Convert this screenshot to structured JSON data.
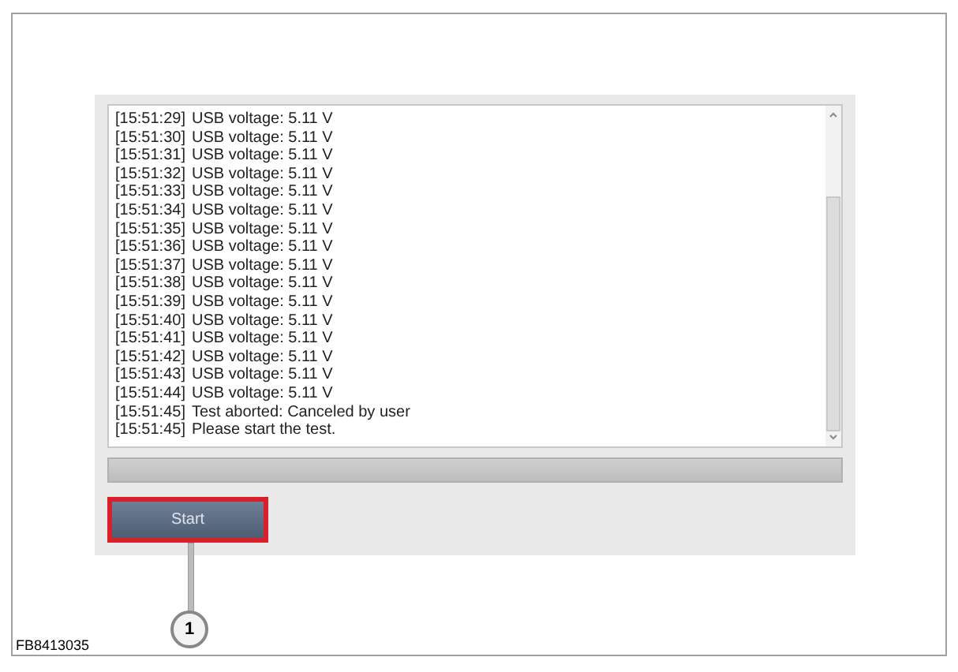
{
  "log": {
    "lines": [
      {
        "time": "[15:51:29]",
        "message": "USB voltage: 5.11 V"
      },
      {
        "time": "[15:51:30]",
        "message": "USB voltage: 5.11 V"
      },
      {
        "time": "[15:51:31]",
        "message": "USB voltage: 5.11 V"
      },
      {
        "time": "[15:51:32]",
        "message": "USB voltage: 5.11 V"
      },
      {
        "time": "[15:51:33]",
        "message": "USB voltage: 5.11 V"
      },
      {
        "time": "[15:51:34]",
        "message": "USB voltage: 5.11 V"
      },
      {
        "time": "[15:51:35]",
        "message": "USB voltage: 5.11 V"
      },
      {
        "time": "[15:51:36]",
        "message": "USB voltage: 5.11 V"
      },
      {
        "time": "[15:51:37]",
        "message": "USB voltage: 5.11 V"
      },
      {
        "time": "[15:51:38]",
        "message": "USB voltage: 5.11 V"
      },
      {
        "time": "[15:51:39]",
        "message": "USB voltage: 5.11 V"
      },
      {
        "time": "[15:51:40]",
        "message": "USB voltage: 5.11 V"
      },
      {
        "time": "[15:51:41]",
        "message": "USB voltage: 5.11 V"
      },
      {
        "time": "[15:51:42]",
        "message": "USB voltage: 5.11 V"
      },
      {
        "time": "[15:51:43]",
        "message": "USB voltage: 5.11 V"
      },
      {
        "time": "[15:51:44]",
        "message": "USB voltage: 5.11 V"
      },
      {
        "time": "[15:51:45]",
        "message": "Test aborted: Canceled by user"
      },
      {
        "time": "[15:51:45]",
        "message": "Please start the test."
      }
    ]
  },
  "progress": {
    "level": 0
  },
  "start_button": {
    "label": "Start",
    "highlighted": true
  },
  "callout": {
    "number": "1"
  },
  "figure_code": "FB8413035"
}
